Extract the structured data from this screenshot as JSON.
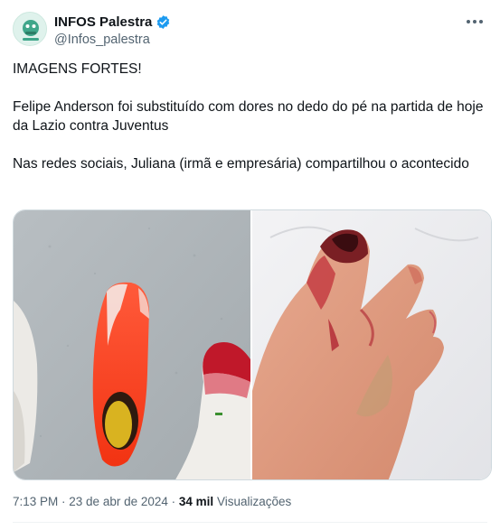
{
  "account": {
    "display_name": "INFOS Palestra",
    "handle": "@Infos_palestra",
    "avatar_icon": "palestra-logo-icon",
    "verified_icon": "verified-badge-icon",
    "more_icon": "more-options-icon"
  },
  "tweet": {
    "paragraphs": [
      "IMAGENS FORTES!",
      "Felipe Anderson foi substituído com dores no dedo do pé na partida de hoje da Lazio contra Juventus",
      "Nas redes sociais, Juliana (irmã e empresária) compartilhou o acontecido"
    ]
  },
  "meta": {
    "time": "7:13 PM",
    "separator": " · ",
    "date": "23 de abr de 2024",
    "views_count": "34 mil",
    "views_label": "Visualizações"
  },
  "colors": {
    "brand_blue": "#1d9bf0",
    "text_primary": "#0f1419",
    "text_secondary": "#536471",
    "avatar_bg": "#dff2ec",
    "avatar_fg": "#3fa68a"
  }
}
